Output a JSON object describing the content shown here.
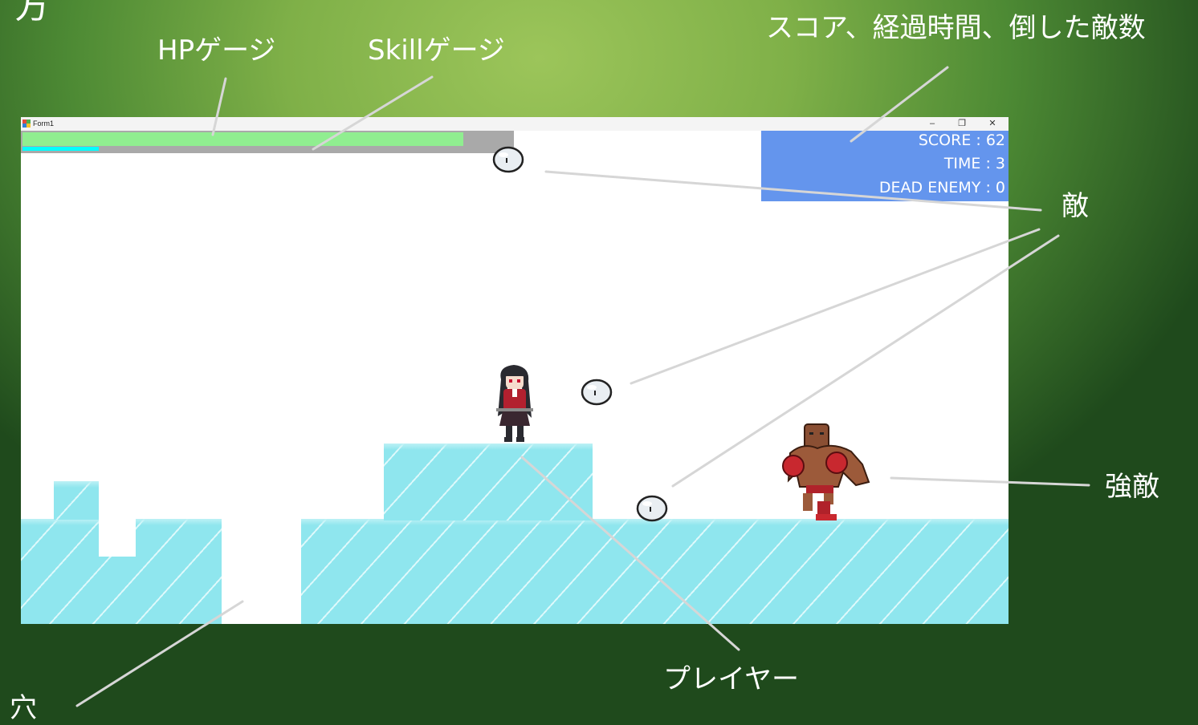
{
  "annotations": {
    "top_left_partial": "方",
    "hp_gauge": "HPゲージ",
    "skill_gauge": "Skillゲージ",
    "hud_description": "スコア、経過時間、倒した敵数",
    "enemy": "敵",
    "strong_enemy": "強敵",
    "player": "プレイヤー",
    "hole": "穴"
  },
  "window": {
    "title": "Form1",
    "buttons": {
      "minimize": "–",
      "restore": "❐",
      "close": "✕"
    }
  },
  "game": {
    "hp_fraction": 0.9,
    "skill_fraction": 0.155,
    "score_line": "SCORE : 62",
    "time_line": "TIME : 3",
    "dead_enemy_line": "DEAD ENEMY : 0",
    "colors": {
      "hp": "#90ee90",
      "skill": "#00ffff",
      "gauge_bg": "#a9a9a9",
      "hud_bg": "#6495ed",
      "ground": "#8fe6ee",
      "background": "#5f9e3f"
    },
    "sprites": [
      "enemy-slime-icon",
      "player-girl-icon",
      "strong-enemy-boxer-icon"
    ]
  }
}
